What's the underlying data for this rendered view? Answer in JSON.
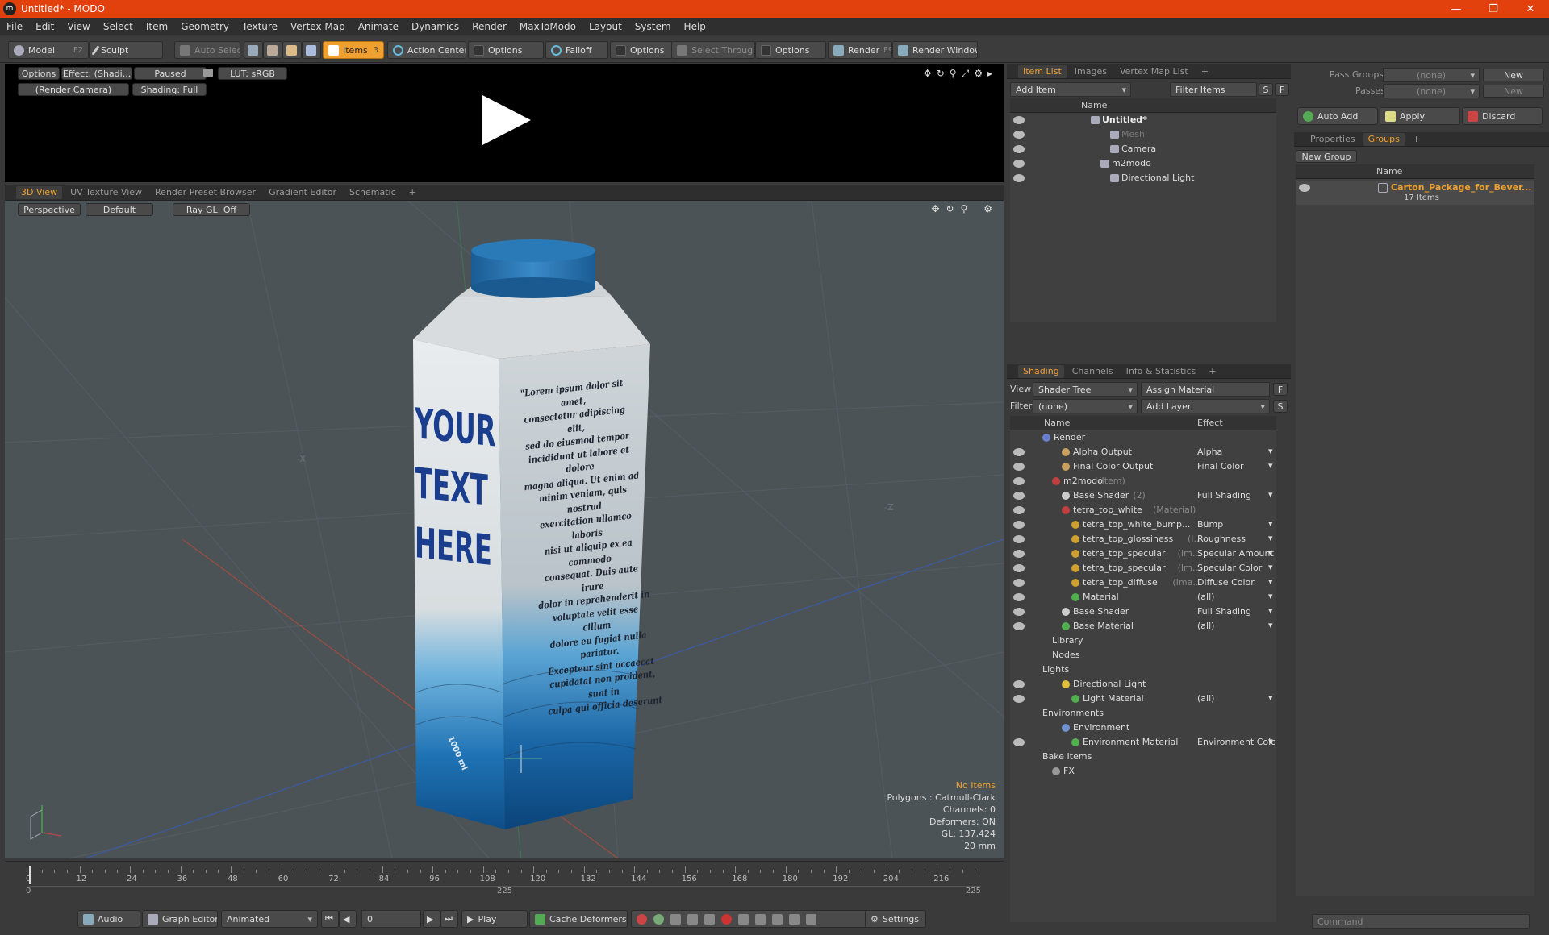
{
  "window": {
    "title": "Untitled* - MODO",
    "logo_letter": "m",
    "min": "—",
    "max": "❐",
    "close": "✕"
  },
  "menu": [
    "File",
    "Edit",
    "View",
    "Select",
    "Item",
    "Geometry",
    "Texture",
    "Vertex Map",
    "Animate",
    "Dynamics",
    "Render",
    "MaxToModo",
    "Layout",
    "System",
    "Help"
  ],
  "toolbar": {
    "model": "Model",
    "model_key": "F2",
    "sculpt": "Sculpt",
    "auto_select": "Auto Select",
    "items": "Items",
    "items_key": "3",
    "action_center": "Action Center",
    "options1": "Options",
    "falloff": "Falloff",
    "options2": "Options",
    "select_through": "Select Through",
    "options3": "Options",
    "render": "Render",
    "render_key": "F9",
    "render_window": "Render Window"
  },
  "preview": {
    "options": "Options",
    "effect": "Effect: (Shadi...",
    "paused": "Paused",
    "lut": "LUT: sRGB",
    "camera": "(Render Camera)",
    "shading": "Shading: Full"
  },
  "viewport_tabs": [
    "3D View",
    "UV Texture View",
    "Render Preset Browser",
    "Gradient Editor",
    "Schematic"
  ],
  "viewport": {
    "perspective": "Perspective",
    "default": "Default",
    "raygl": "Ray GL: Off",
    "axis_x": "-X",
    "axis_z": "-Z",
    "info": {
      "no_items": "No Items",
      "polygons": "Polygons : Catmull-Clark",
      "channels": "Channels: 0",
      "deformers": "Deformers: ON",
      "gl": "GL: 137,424",
      "scale": "20 mm"
    },
    "colors": {
      "bg": "#4b5357",
      "accent": "#f0a030"
    }
  },
  "carton": {
    "title_lines": [
      "YOUR",
      "TEXT",
      "HERE"
    ],
    "lorem": [
      "\"Lorem ipsum dolor sit amet,",
      "consectetur adipiscing elit,",
      "sed do eiusmod tempor",
      "incididunt ut labore et dolore",
      "magna aliqua. Ut enim ad",
      "minim veniam, quis nostrud",
      "exercitation ullamco laboris",
      "nisi ut aliquip ex ea commodo",
      "consequat. Duis aute irure",
      "dolor in reprehenderit in",
      "voluptate velit esse cillum",
      "dolore eu fugiat nulla pariatur.",
      "Excepteur sint occaecat",
      "cupidatat non proident, sunt in",
      "culpa qui officia deserunt"
    ],
    "bottom_text": "1000 ml"
  },
  "timeline": {
    "ticks": [
      "0",
      "12",
      "24",
      "36",
      "48",
      "60",
      "72",
      "84",
      "96",
      "108",
      "120",
      "132",
      "144",
      "156",
      "168",
      "180",
      "192",
      "204",
      "216"
    ],
    "start": "0",
    "mid": "225",
    "end": "225"
  },
  "bottombar": {
    "audio": "Audio",
    "graph_editor": "Graph Editor",
    "animated": "Animated",
    "frame": "0",
    "play": "Play",
    "cache_deformers": "Cache Deformers",
    "settings": "Settings"
  },
  "itemlist": {
    "tabs": [
      "Item List",
      "Images",
      "Vertex Map List"
    ],
    "add_item": "Add Item",
    "filter_items": "Filter Items",
    "s": "S",
    "f": "F",
    "col_name": "Name",
    "rows": [
      {
        "label": "Untitled*",
        "indent": 0
      },
      {
        "label": "Mesh",
        "indent": 2
      },
      {
        "label": "Camera",
        "indent": 2
      },
      {
        "label": "m2modo",
        "indent": 1
      },
      {
        "label": "Directional Light",
        "indent": 2
      }
    ]
  },
  "shading": {
    "tabs": [
      "Shading",
      "Channels",
      "Info & Statistics"
    ],
    "view_label": "View",
    "view_value": "Shader Tree",
    "assign_material": "Assign Material",
    "filter_label": "Filter",
    "filter_value": "(none)",
    "add_layer": "Add Layer",
    "f": "F",
    "s": "S",
    "col_name": "Name",
    "col_effect": "Effect",
    "rows": [
      {
        "name": "Render",
        "sub": "",
        "effect": "",
        "indent": 0,
        "eye": false,
        "icon": "#6a7fd0"
      },
      {
        "name": "Alpha Output",
        "sub": "",
        "effect": "Alpha",
        "indent": 2,
        "eye": true,
        "icon": "#c8a060"
      },
      {
        "name": "Final Color Output",
        "sub": "",
        "effect": "Final Color",
        "indent": 2,
        "eye": true,
        "icon": "#c8a060"
      },
      {
        "name": "m2modo",
        "sub": "(Item)",
        "effect": "",
        "indent": 1,
        "eye": true,
        "icon": "#c04040"
      },
      {
        "name": "Base Shader",
        "sub": "(2)",
        "effect": "Full Shading",
        "indent": 2,
        "eye": true,
        "icon": "#cccccc"
      },
      {
        "name": "tetra_top_white",
        "sub": "(Material)",
        "effect": "",
        "indent": 2,
        "eye": true,
        "icon": "#c04040"
      },
      {
        "name": "tetra_top_white_bump...",
        "sub": "(I...",
        "effect": "Bump",
        "indent": 3,
        "eye": true,
        "icon": "#d0a030"
      },
      {
        "name": "tetra_top_glossiness",
        "sub": "(I...",
        "effect": "Roughness",
        "indent": 3,
        "eye": true,
        "icon": "#d0a030"
      },
      {
        "name": "tetra_top_specular",
        "sub": "(Im...",
        "effect": "Specular Amount",
        "indent": 3,
        "eye": true,
        "icon": "#d0a030"
      },
      {
        "name": "tetra_top_specular",
        "sub": "(Im...",
        "effect": "Specular Color",
        "indent": 3,
        "eye": true,
        "icon": "#d0a030"
      },
      {
        "name": "tetra_top_diffuse",
        "sub": "(Ima...",
        "effect": "Diffuse Color",
        "indent": 3,
        "eye": true,
        "icon": "#d0a030"
      },
      {
        "name": "Material",
        "sub": "",
        "effect": "(all)",
        "indent": 3,
        "eye": true,
        "icon": "#50b050"
      },
      {
        "name": "Base Shader",
        "sub": "",
        "effect": "Full Shading",
        "indent": 2,
        "eye": true,
        "icon": "#cccccc"
      },
      {
        "name": "Base Material",
        "sub": "",
        "effect": "(all)",
        "indent": 2,
        "eye": true,
        "icon": "#50b050"
      },
      {
        "name": "Library",
        "sub": "",
        "effect": "",
        "indent": 1,
        "eye": false,
        "icon": ""
      },
      {
        "name": "Nodes",
        "sub": "",
        "effect": "",
        "indent": 1,
        "eye": false,
        "icon": ""
      },
      {
        "name": "Lights",
        "sub": "",
        "effect": "",
        "indent": 0,
        "eye": false,
        "icon": ""
      },
      {
        "name": "Directional Light",
        "sub": "",
        "effect": "",
        "indent": 2,
        "eye": true,
        "icon": "#e0c040"
      },
      {
        "name": "Light Material",
        "sub": "",
        "effect": "(all)",
        "indent": 3,
        "eye": true,
        "icon": "#50b050"
      },
      {
        "name": "Environments",
        "sub": "",
        "effect": "",
        "indent": 0,
        "eye": false,
        "icon": ""
      },
      {
        "name": "Environment",
        "sub": "",
        "effect": "",
        "indent": 2,
        "eye": false,
        "icon": "#7090d0"
      },
      {
        "name": "Environment Material",
        "sub": "",
        "effect": "Environment Color",
        "indent": 3,
        "eye": true,
        "icon": "#50b050"
      },
      {
        "name": "Bake Items",
        "sub": "",
        "effect": "",
        "indent": 0,
        "eye": false,
        "icon": ""
      },
      {
        "name": "FX",
        "sub": "",
        "effect": "",
        "indent": 1,
        "eye": false,
        "icon": "#999999"
      }
    ]
  },
  "groups": {
    "pass_groups": "Pass Groups",
    "pass_groups_value": "(none)",
    "new": "New",
    "passes": "Passes",
    "passes_value": "(none)",
    "new2": "New",
    "auto_add": "Auto Add",
    "apply": "Apply",
    "discard": "Discard",
    "tabs": [
      "Properties",
      "Groups"
    ],
    "new_group": "New Group",
    "col_name": "Name",
    "group_name": "Carton_Package_for_Bever...",
    "group_count": "17 Items",
    "command_placeholder": "Command"
  }
}
